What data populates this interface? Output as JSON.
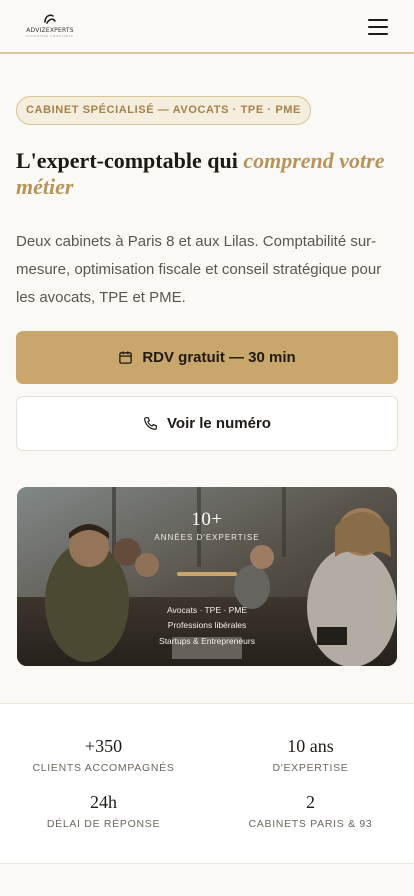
{
  "header": {
    "logo_text": "ADVIZEXPERTS",
    "logo_tagline": "EXPERTISE COMPTABLE",
    "logo_icon": "advizexperts-logo-icon",
    "menu_icon": "hamburger-menu-icon"
  },
  "hero": {
    "badge": "CABINET SPÉCIALISÉ — AVOCATS · TPE · PME",
    "headline_main": "L'expert-comptable qui ",
    "headline_accent": "comprend votre métier",
    "lead": "Deux cabinets à Paris 8 et aux Lilas. Comptabilité sur-mesure, optimisation fiscale et conseil stratégique pour les avocats, TPE et PME.",
    "primary_cta": {
      "label": "RDV gratuit — 30 min",
      "icon": "calendar-icon"
    },
    "secondary_cta": {
      "label": "Voir le numéro",
      "icon": "phone-icon"
    }
  },
  "photo_overlay": {
    "big_number": "10+",
    "caption": "ANNÉES D'EXPERTISE",
    "lines": [
      "Avocats · TPE · PME",
      "Professions libérales",
      "Startups & Entrepreneurs"
    ]
  },
  "stats": [
    {
      "value": "+350",
      "label": "CLIENTS ACCOMPAGNÉS"
    },
    {
      "value": "10 ans",
      "label": "D'EXPERTISE"
    },
    {
      "value": "24h",
      "label": "DÉLAI DE RÉPONSE"
    },
    {
      "value": "2",
      "label": "CABINETS PARIS & 93"
    }
  ],
  "colors": {
    "accent_gold": "#c9a66b",
    "accent_text": "#b8945a",
    "background": "#fbf9f5"
  }
}
